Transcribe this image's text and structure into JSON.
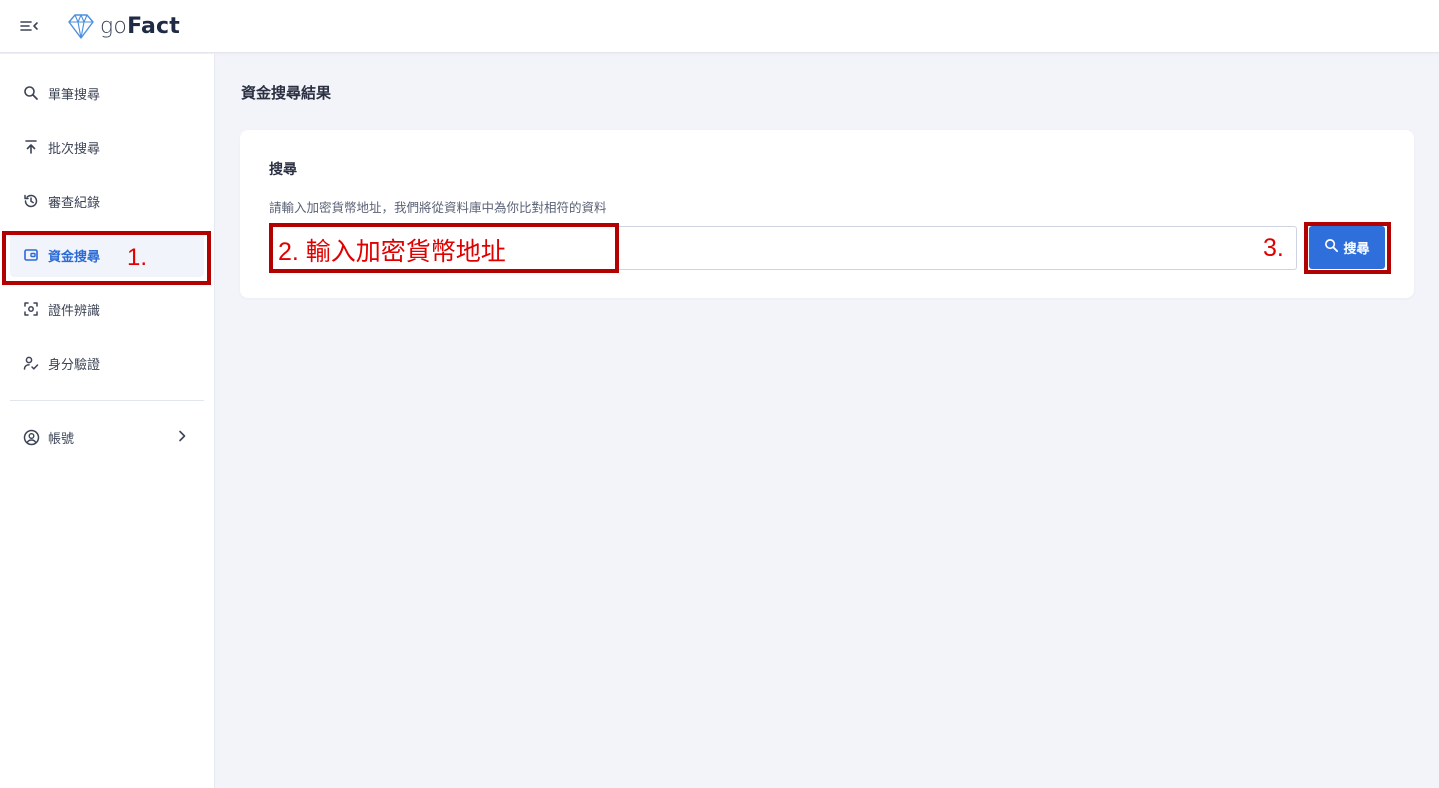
{
  "header": {
    "logo_go": "go",
    "logo_fact": "Fact"
  },
  "sidebar": {
    "items": [
      {
        "label": "單筆搜尋",
        "icon": "search-icon"
      },
      {
        "label": "批次搜尋",
        "icon": "upload-icon"
      },
      {
        "label": "審查紀錄",
        "icon": "history-icon"
      },
      {
        "label": "資金搜尋",
        "icon": "wallet-icon",
        "active": true
      },
      {
        "label": "證件辨識",
        "icon": "scan-icon"
      },
      {
        "label": "身分驗證",
        "icon": "user-check-icon"
      }
    ],
    "account": {
      "label": "帳號",
      "icon": "account-circle-icon"
    }
  },
  "main": {
    "title": "資金搜尋結果",
    "card": {
      "title": "搜尋",
      "description": "請輸入加密貨幣地址，我們將從資料庫中為你比對相符的資料",
      "input_value": "",
      "search_button": "搜尋"
    }
  },
  "annotations": {
    "step1": "1.",
    "step2": "2. 輸入加密貨幣地址",
    "step3": "3."
  },
  "colors": {
    "accent": "#2f6fdc",
    "annotation": "#e00000"
  }
}
